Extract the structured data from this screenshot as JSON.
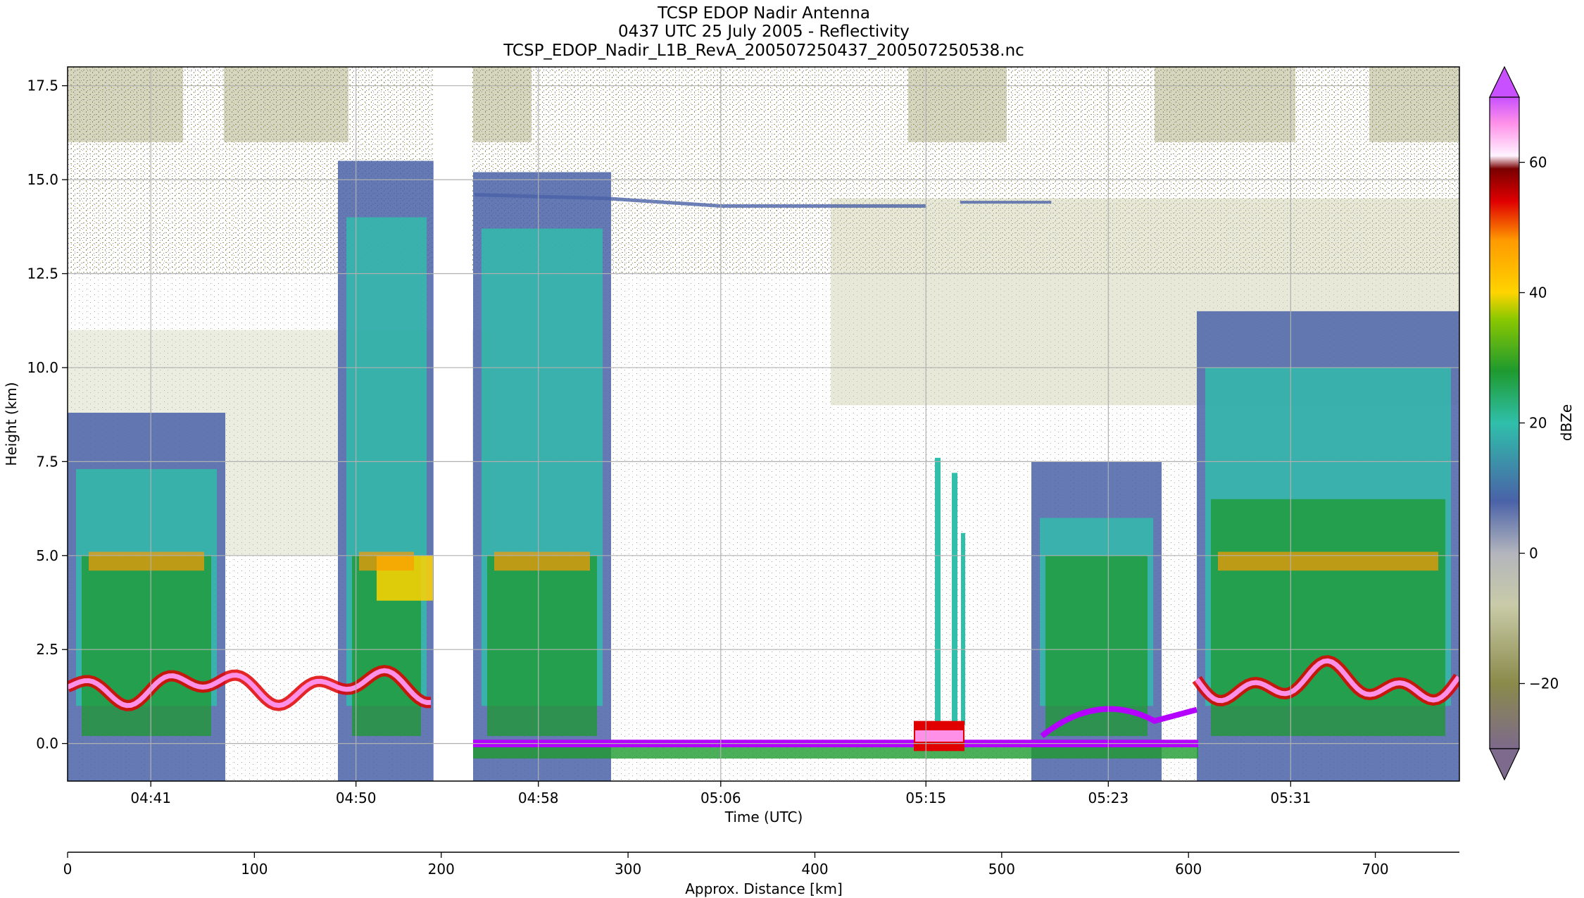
{
  "chart_data": {
    "type": "heatmap",
    "title_lines": [
      "TCSP EDOP Nadir Antenna",
      "0437 UTC 25 July 2005 - Reflectivity",
      "TCSP_EDOP_Nadir_L1B_RevA_200507250437_200507250538.nc"
    ],
    "xlabel": "Time (UTC)",
    "ylabel": "Height (km)",
    "x2label": "Approx. Distance [km]",
    "colorbar_label": "dBZe",
    "x_ticks": [
      "04:41",
      "04:50",
      "04:58",
      "05:06",
      "05:15",
      "05:23",
      "05:31"
    ],
    "x_tick_minutes": [
      41,
      50,
      58,
      66,
      75,
      83,
      91
    ],
    "x_minutes_range": [
      37.35,
      98.4
    ],
    "y_ticks": [
      "0.0",
      "2.5",
      "5.0",
      "7.5",
      "10.0",
      "12.5",
      "15.0",
      "17.5"
    ],
    "y_tick_values": [
      0.0,
      2.5,
      5.0,
      7.5,
      10.0,
      12.5,
      15.0,
      17.5
    ],
    "ylim": [
      -1.0,
      18.0
    ],
    "x2_ticks": [
      "0",
      "100",
      "200",
      "300",
      "400",
      "500",
      "600",
      "700"
    ],
    "x2_tick_values": [
      0,
      100,
      200,
      300,
      400,
      500,
      600,
      700
    ],
    "x2_range": [
      0,
      745
    ],
    "colorbar_ticks": [
      "60",
      "40",
      "20",
      "0",
      "−20"
    ],
    "colorbar_tick_values": [
      60,
      40,
      20,
      0,
      -20
    ],
    "colorbar_range": [
      -30,
      70
    ],
    "grid": true,
    "data_gap_minutes": [
      53.4,
      55.1
    ],
    "melting_layer_km": 5.0,
    "tropopause_echo_km": 14.4,
    "surface_echo_km": 0.0,
    "colors": {
      "bg": "#ffffff",
      "low": "#7d6a8c",
      "olive": "#8a8a4a",
      "pale": "#c9cba8",
      "gray": "#b3b5bd",
      "blue": "#4a62a8",
      "teal": "#2fbfaa",
      "green": "#1e9a2e",
      "yellow": "#ffd400",
      "orange": "#ff9a00",
      "red": "#e00000",
      "darkred": "#7a0000",
      "pink": "#ff90e8",
      "magenta": "#b300ff"
    }
  }
}
